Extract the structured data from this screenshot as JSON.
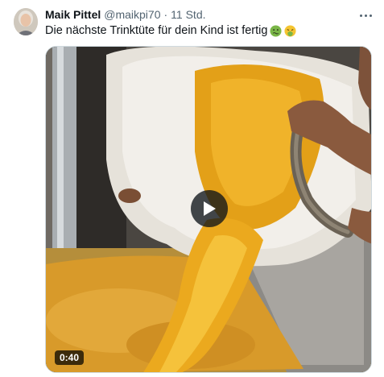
{
  "tweet": {
    "author_name": "Maik Pittel",
    "author_handle": "@maikpi70",
    "separator": "·",
    "timestamp": "11 Std.",
    "text": "Die nächste Trinktüte für dein Kind ist fertig",
    "emojis": [
      "nauseated-face-emoji",
      "vomiting-face-emoji"
    ]
  },
  "media": {
    "type": "video",
    "duration": "0:40",
    "icons": {
      "play": "play-icon",
      "more": "more-options-icon"
    }
  },
  "colors": {
    "text_primary": "#0f1419",
    "text_secondary": "#536471",
    "border": "#cfd9de",
    "liquid": "#e9a51a"
  }
}
